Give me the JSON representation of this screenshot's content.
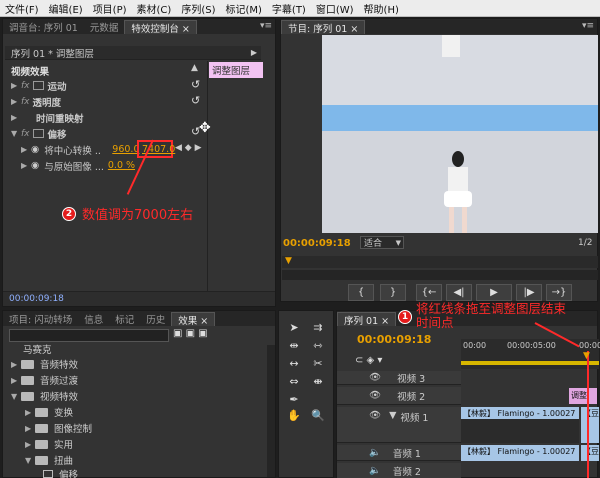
{
  "menu": [
    "文件(F)",
    "编辑(E)",
    "项目(P)",
    "素材(C)",
    "序列(S)",
    "标记(M)",
    "字幕(T)",
    "窗口(W)",
    "帮助(H)"
  ],
  "ec_panel": {
    "tabs": [
      "调音台: 序列 01",
      "元数据",
      "特效控制台 ×"
    ],
    "header": "序列 01 * 调整图层",
    "tag": "调整图层",
    "section": "视频效果",
    "rows": [
      "运动",
      "透明度",
      "时间重映射",
      "偏移"
    ],
    "param1_label": "将中心转换 ...",
    "param1_x": "960.0",
    "param1_y": "7407.0",
    "param2_label": "与原始图像 ...",
    "param2_value": "0.0 %",
    "timecode": "00:00:09:18"
  },
  "monitor": {
    "tab": "节目: 序列 01 ×",
    "timecode": "00:00:09:18",
    "fit": "适合",
    "page": "1/2"
  },
  "proj_panel": {
    "tabs": [
      "项目: 闪动转场",
      "信息",
      "标记",
      "历史",
      "效果 ×"
    ],
    "tree": [
      "马赛克",
      "音频特效",
      "音频过渡",
      "视频特效",
      "变换",
      "图像控制",
      "实用",
      "扭曲",
      "偏移"
    ]
  },
  "timeline": {
    "tab": "序列 01 ×",
    "timecode": "00:00:09:18",
    "ruler": [
      "00:00",
      "00:00:05:00",
      "00:00:1"
    ],
    "tracks": [
      "视频 3",
      "视频 2",
      "视频 1",
      "音频 1",
      "音频 2"
    ],
    "clip_adjust": "调整",
    "clip_video": "【林毅】 Flamingo - 1.00027",
    "clip_video2": "【豆",
    "clip_audio": "【林毅】 Flamingo - 1.00027",
    "clip_audio2": "【豆"
  },
  "annotations": {
    "a1_num": "1",
    "a1_text": "将红线条拖至调整图层结束时间点",
    "a2_num": "2",
    "a2_text": "数值调为7000左右"
  },
  "colors": {
    "annotation": "#ff2a2a",
    "value": "#e8a000",
    "tag": "#f3c3f3",
    "clip_video": "#a7c6e6",
    "clip_adjust": "#e0a6e0"
  }
}
